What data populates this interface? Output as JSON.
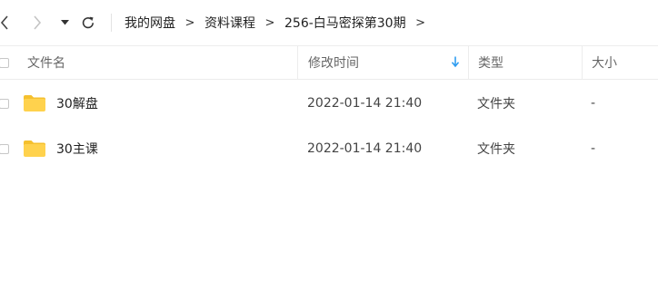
{
  "toolbar": {
    "back_icon": "chevron-left-icon",
    "forward_icon": "chevron-right-icon",
    "dropdown_icon": "caret-down-icon",
    "refresh_icon": "refresh-icon",
    "breadcrumb": [
      "我的网盘",
      "资料课程",
      "256-白马密探第30期"
    ],
    "separator": ">"
  },
  "table": {
    "headers": {
      "name": "文件名",
      "mtime": "修改时间",
      "type": "类型",
      "size": "大小"
    },
    "sort_icon": "sort-down-arrow-icon",
    "rows": [
      {
        "name": "30解盘",
        "mtime": "2022-01-14 21:40",
        "type": "文件夹",
        "size": "-"
      },
      {
        "name": "30主课",
        "mtime": "2022-01-14 21:40",
        "type": "文件夹",
        "size": "-"
      }
    ]
  },
  "colors": {
    "folder": "#FFD24D",
    "folder_tab": "#F5C02E",
    "sort_arrow": "#2E9CF0",
    "divider": "#ECECEC"
  }
}
